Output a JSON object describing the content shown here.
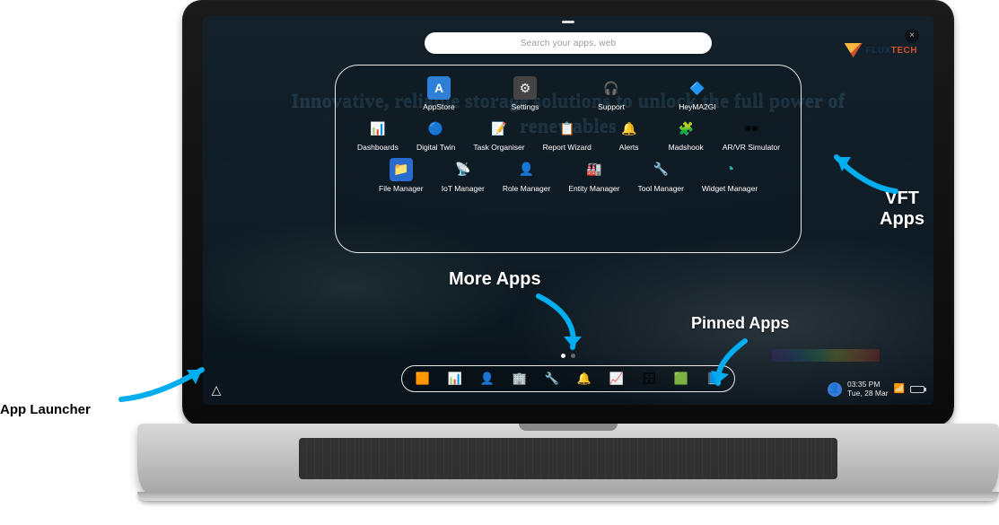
{
  "search": {
    "placeholder": "Search your apps, web"
  },
  "brand": {
    "name_part1": "FLUX",
    "name_part2": "TECH"
  },
  "tagline": "Innovative, reliable storage solutions to unlock the full power of renewables",
  "clock": {
    "time": "03:35 PM",
    "date": "Tue, 28 Mar"
  },
  "close_glyph": "×",
  "launcher_glyph": "△",
  "apps_row1": [
    {
      "label": "AppStore"
    },
    {
      "label": "Settings"
    },
    {
      "label": "Support"
    },
    {
      "label": "HeyMA2GI"
    }
  ],
  "apps_row2": [
    {
      "label": "Dashboards"
    },
    {
      "label": "Digital Twin"
    },
    {
      "label": "Task Organiser"
    },
    {
      "label": "Report Wizard"
    },
    {
      "label": "Alerts"
    },
    {
      "label": "Madshook"
    },
    {
      "label": "AR/VR Simulator"
    }
  ],
  "apps_row3": [
    {
      "label": "File Manager"
    },
    {
      "label": "IoT Manager"
    },
    {
      "label": "Role Manager"
    },
    {
      "label": "Entity Manager"
    },
    {
      "label": "Tool Manager"
    },
    {
      "label": "Widget Manager"
    }
  ],
  "callouts": {
    "more_apps": "More Apps",
    "pinned_apps": "Pinned Apps",
    "vft_apps_line1": "VFT",
    "vft_apps_line2": "Apps",
    "app_launcher": "App Launcher"
  }
}
